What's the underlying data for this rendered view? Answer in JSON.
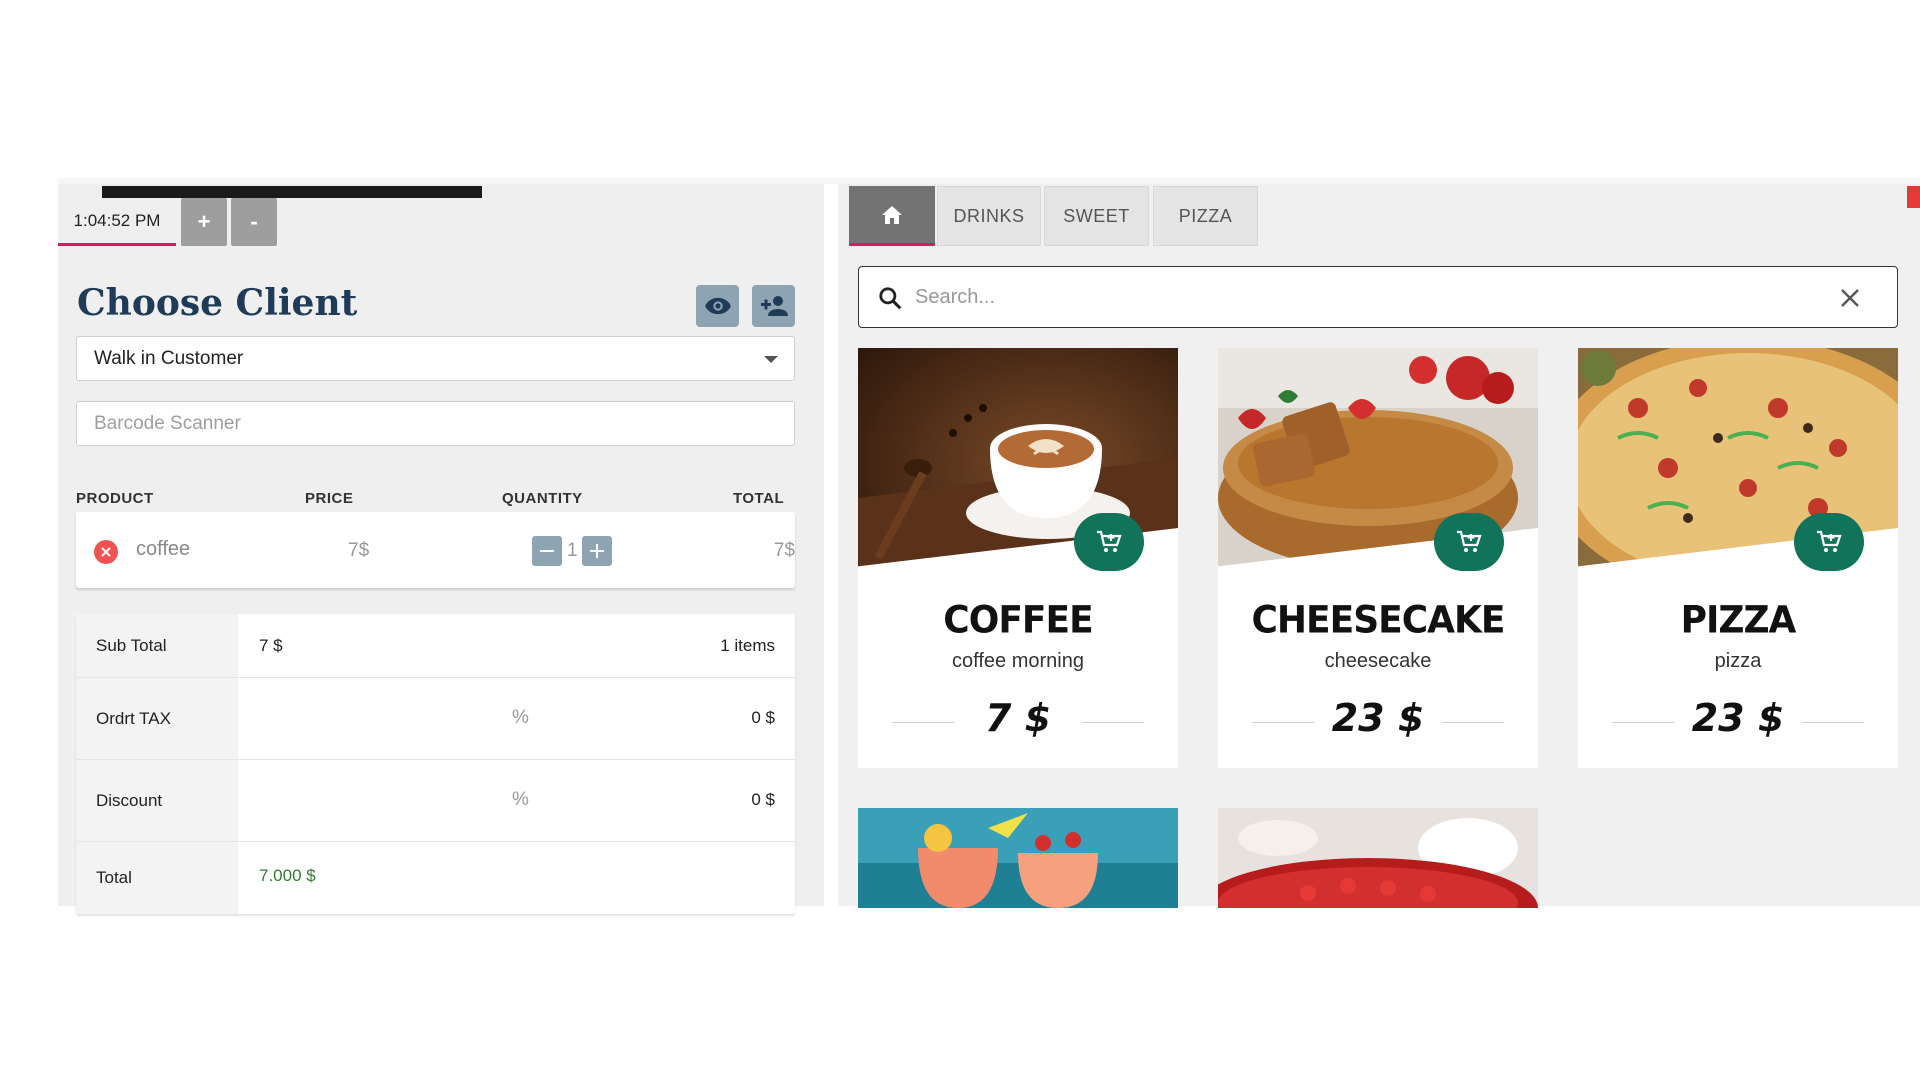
{
  "pos": {
    "time": "1:04:52 PM",
    "plus_label": "+",
    "minus_label": "-"
  },
  "client": {
    "title": "Choose Client",
    "view_icon": "eye-icon",
    "add_icon": "person-add-icon",
    "selected": "Walk in Customer"
  },
  "barcode": {
    "placeholder": "Barcode Scanner"
  },
  "cart_table": {
    "columns": [
      "PRODUCT",
      "PRICE",
      "QUANTITY",
      "TOTAL"
    ],
    "rows": [
      {
        "name": "coffee",
        "price": "7$",
        "qty": "1",
        "total": "7$"
      }
    ]
  },
  "summary": {
    "subtotal_label": "Sub Total",
    "subtotal_value": "7 $",
    "items": "1 items",
    "tax_label": "Ordrt TAX",
    "tax_pct": "%",
    "tax_value": "0 $",
    "discount_label": "Discount",
    "discount_pct": "%",
    "discount_value": "0 $",
    "total_label": "Total",
    "total_value": "7.000 $"
  },
  "tabs": [
    "DRINKS",
    "SWEET",
    "PIZZA"
  ],
  "search": {
    "placeholder": "Search..."
  },
  "products": [
    {
      "title": "COFFEE",
      "subtitle": "coffee morning",
      "price": "7 $"
    },
    {
      "title": "CHEESECAKE",
      "subtitle": "cheesecake",
      "price": "23 $"
    },
    {
      "title": "PIZZA",
      "subtitle": "pizza",
      "price": "23 $"
    }
  ],
  "colors": {
    "accent": "#d81b60",
    "cart_button": "#10735a",
    "title": "#1f3b57",
    "total_green": "#2e7d32",
    "remove_red": "#ef5350"
  }
}
